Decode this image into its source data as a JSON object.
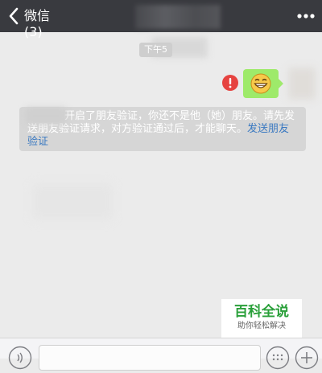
{
  "nav": {
    "back_label": "微信(3)",
    "back_icon": "chevron-left-icon",
    "more_icon": "more-dots-icon"
  },
  "chat": {
    "timestamp": "下午5",
    "outgoing_message": {
      "content_icon": "grinning-emoji-icon",
      "status_icon": "send-failed-icon",
      "status_color": "#e64340"
    },
    "system_notice": {
      "text": "开启了朋友验证，你还不是他（她）朋友。请先发送朋友验证请求，对方验证通过后，才能聊天。",
      "link_text": "发送朋友验证"
    }
  },
  "watermark": {
    "title": "百科全说",
    "subtitle": "助你轻松解决"
  },
  "input_bar": {
    "voice_icon": "voice-icon",
    "emoji_icon": "emoji-keyboard-icon",
    "plus_icon": "plus-icon"
  },
  "colors": {
    "nav_bg": "#393a3f",
    "chat_bg": "#ebebeb",
    "bubble_out": "#9eea6a",
    "link": "#3a79c1",
    "watermark_green": "#2aa03a"
  }
}
